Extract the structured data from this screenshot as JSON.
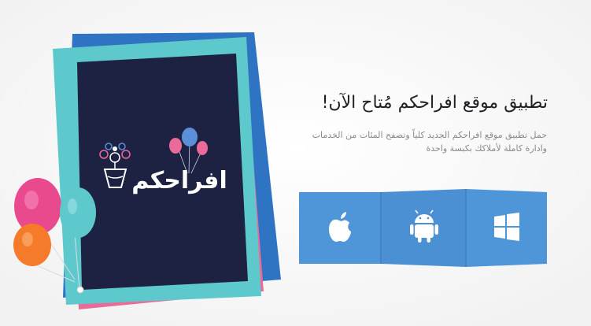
{
  "hero": {
    "headline": "تطبيق موقع افراحكم مُتاح الآن!",
    "description_line1": "حمل تطبيق موقع افراحكم الجديد كلياً وتصفح المئات من الخدمات",
    "description_line2": "وادارة كاملة لأملاكك بكبسة واحدة"
  },
  "logo": {
    "wordmark": "افراحكم"
  },
  "stores": [
    {
      "name": "apple-store",
      "icon": "apple-icon"
    },
    {
      "name": "android-store",
      "icon": "android-icon"
    },
    {
      "name": "windows-store",
      "icon": "windows-icon"
    }
  ],
  "colors": {
    "blue": "#2f74c2",
    "pink": "#ec6a99",
    "teal": "#5ec9cc",
    "navy": "#1d2142",
    "button": "#4e96d8",
    "button_edge": "#3f7fbd"
  }
}
